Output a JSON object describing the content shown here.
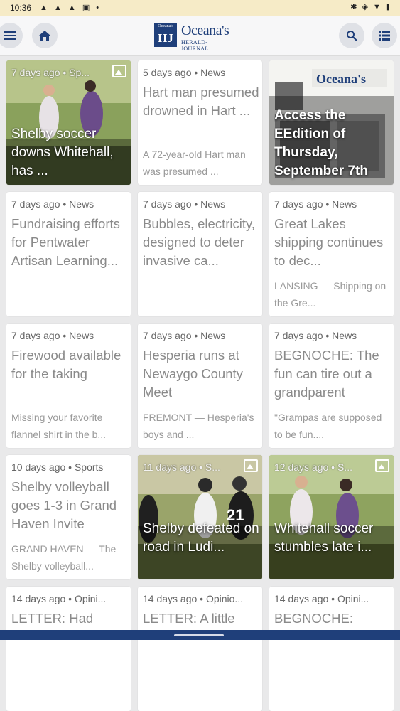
{
  "status": {
    "time": "10:36",
    "notification_icons": "▲ ▲ ▲ ▣ •",
    "system_icons": "✱ ◈ ▼ ▮"
  },
  "header": {
    "logo_text": "Oceana's",
    "logo_sub": "HERALD-JOURNAL",
    "logo_mark": "HJ",
    "logo_mark_small": "Oceana's"
  },
  "colors": {
    "brand": "#1f3f7a",
    "status_bar": "#f6ebc7",
    "background": "#e9e9ea"
  },
  "icons": {
    "menu": "menu-icon",
    "home": "home-icon",
    "search": "search-icon",
    "list": "list-view-icon"
  },
  "cards": [
    {
      "meta": "7 days ago • Sp...",
      "title": "Shelby soccer downs Whitehall, has ...",
      "excerpt": "",
      "image": true
    },
    {
      "meta": "5 days ago • News",
      "title": "Hart man presumed drowned in Hart ...",
      "excerpt": "A 72-year-old Hart man was presumed ..."
    },
    {
      "meta": "",
      "title": "Access the EEdition of Thursday, September  7th",
      "excerpt": "",
      "image": true
    },
    {
      "meta": "7 days ago • News",
      "title": "Fundraising efforts for Pentwater Artisan Learning...",
      "excerpt": ""
    },
    {
      "meta": "7 days ago • News",
      "title": "Bubbles, electricity, designed to deter invasive ca...",
      "excerpt": ""
    },
    {
      "meta": "7 days ago • News",
      "title": "Great Lakes shipping continues to dec...",
      "excerpt": "LANSING — Shipping on the Gre..."
    },
    {
      "meta": "7 days ago • News",
      "title": "Firewood available for the taking",
      "excerpt": "Missing your favorite flannel shirt in the b..."
    },
    {
      "meta": "7 days ago • News",
      "title": "Hesperia runs at Newaygo County Meet",
      "excerpt": "FREMONT — Hesperia's boys and ..."
    },
    {
      "meta": "7 days ago • News",
      "title": "BEGNOCHE: The fun can tire out a grandparent",
      "excerpt": "\"Grampas are supposed to be fun...."
    },
    {
      "meta": "10 days ago • Sports",
      "title": "Shelby volleyball goes 1-3 in Grand Haven Invite",
      "excerpt": "GRAND HAVEN — The Shelby volleyball..."
    },
    {
      "meta": "11 days ago • S...",
      "title": "Shelby defeated on road in Ludi...",
      "excerpt": "",
      "image": true
    },
    {
      "meta": "12 days ago • S...",
      "title": "Whitehall soccer stumbles late i...",
      "excerpt": "",
      "image": true
    },
    {
      "meta": "14 days ago • Opini...",
      "title": "LETTER: Had",
      "excerpt": ""
    },
    {
      "meta": "14 days ago • Opinio...",
      "title": "LETTER: A little",
      "excerpt": ""
    },
    {
      "meta": "14 days ago • Opini...",
      "title": "BEGNOCHE:",
      "excerpt": ""
    }
  ]
}
